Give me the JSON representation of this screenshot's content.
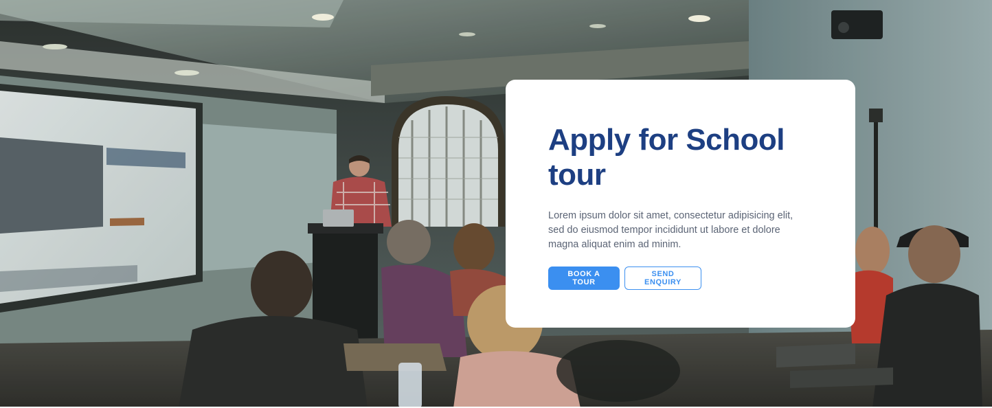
{
  "hero": {
    "background_photo": "classroom-presentation-photo",
    "card": {
      "title": "Apply for School tour",
      "description": "Lorem ipsum dolor sit amet, consectetur adipisicing elit, sed do eiusmod tempor incididunt ut labore et dolore magna aliquat enim ad minim.",
      "primary_button": "BOOK A TOUR",
      "secondary_button": "SEND ENQUIRY"
    }
  },
  "colors": {
    "title": "#1d3f82",
    "accent": "#3b8ff0",
    "body_text": "#5b6475",
    "card_background": "#ffffff"
  }
}
